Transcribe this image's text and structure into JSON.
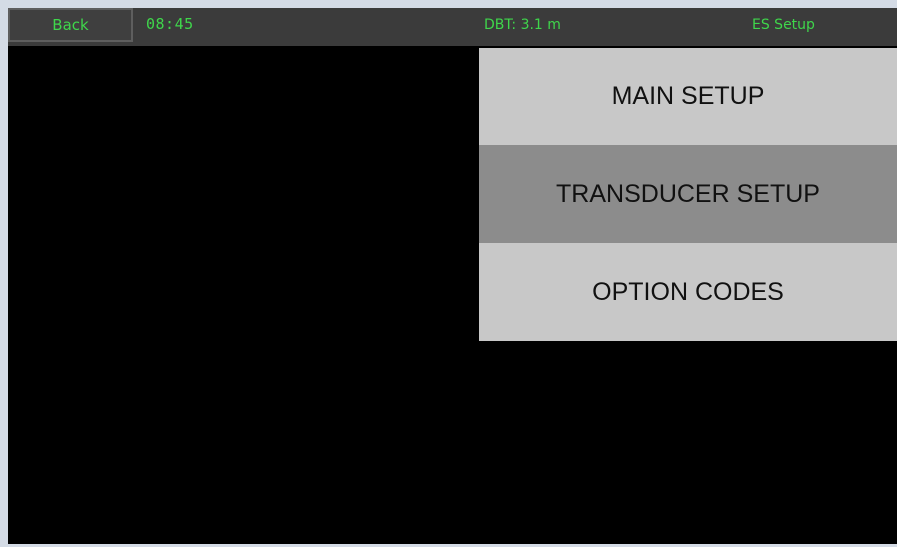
{
  "header": {
    "back_label": "Back",
    "time": "08:45",
    "depth": "DBT: 3.1 m",
    "screen_title": "ES Setup"
  },
  "menu": {
    "items": [
      {
        "label": "MAIN SETUP",
        "selected": false
      },
      {
        "label": "TRANSDUCER SETUP",
        "selected": true
      },
      {
        "label": "OPTION CODES",
        "selected": false
      }
    ]
  },
  "colors": {
    "status_text": "#3fd64b",
    "background": "#000000",
    "menu_item": "#c8c8c8",
    "menu_item_selected": "#8c8c8c"
  }
}
